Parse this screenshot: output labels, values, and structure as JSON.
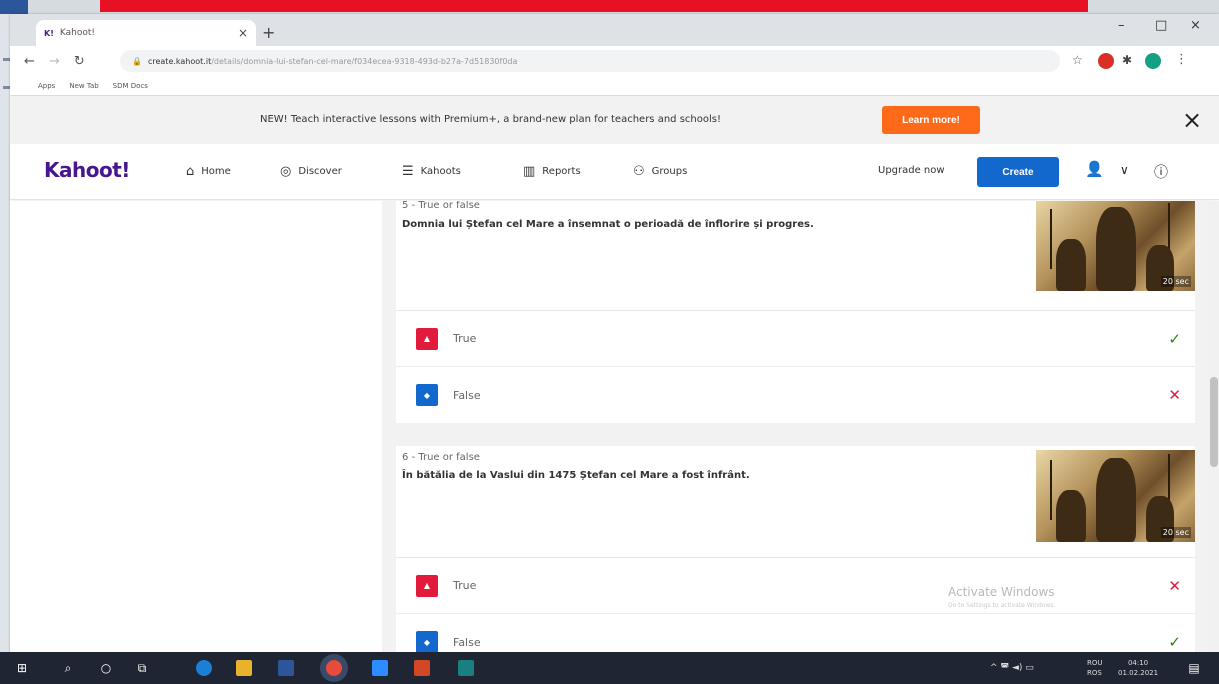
{
  "browser": {
    "tab_title": "Kahoot!",
    "tab_favicon": "K!",
    "tab_close": "×",
    "new_tab": "+",
    "url_domain": "create.kahoot.it",
    "url_path": "/details/domnia-lui-stefan-cel-mare/f034ecea-9318-493d-b27a-7d51830f0da",
    "bookmarks": [
      "Apps",
      "New Tab",
      "SDM Docs"
    ],
    "window_controls": [
      "–",
      "□",
      "×"
    ]
  },
  "banner": {
    "text": "NEW! Teach interactive lessons with Premium+, a brand-new plan for teachers and schools!",
    "button": "Learn more!",
    "close": "×"
  },
  "nav": {
    "logo": "Kahoot!",
    "items": [
      {
        "label": "Home",
        "icon": "⌂"
      },
      {
        "label": "Discover",
        "icon": "◎"
      },
      {
        "label": "Kahoots",
        "icon": "☰"
      },
      {
        "label": "Reports",
        "icon": "▥"
      },
      {
        "label": "Groups",
        "icon": "⚇"
      }
    ],
    "upgrade": "Upgrade now",
    "create": "Create"
  },
  "questions": [
    {
      "label": "5 - True or false",
      "text": "Domnia lui Ștefan cel Mare a însemnat o perioadă de înflorire și progres.",
      "time": "20 sec",
      "answers": [
        {
          "text": "True",
          "correct": "✓"
        },
        {
          "text": "False",
          "correct": "✕"
        }
      ]
    },
    {
      "label": "6 - True or false",
      "text": "În bătălia de la Vaslui din 1475 Ștefan cel Mare a fost înfrânt.",
      "time": "20 sec",
      "answers": [
        {
          "text": "True",
          "correct": "✕"
        },
        {
          "text": "False",
          "correct": "✓"
        }
      ]
    }
  ],
  "watermark": {
    "title": "Activate Windows",
    "subtitle": "Go to Settings to activate Windows."
  },
  "taskbar": {
    "lang_top": "ROU",
    "lang_bottom": "ROS",
    "time": "04:10",
    "date": "01.02.2021"
  },
  "colors": {
    "kahoot_purple": "#46178f",
    "create_blue": "#1368ce",
    "learn_orange": "#ff6a1a",
    "answer_red": "#e21b3c",
    "answer_blue": "#1368ce",
    "check_green": "#26890c"
  }
}
